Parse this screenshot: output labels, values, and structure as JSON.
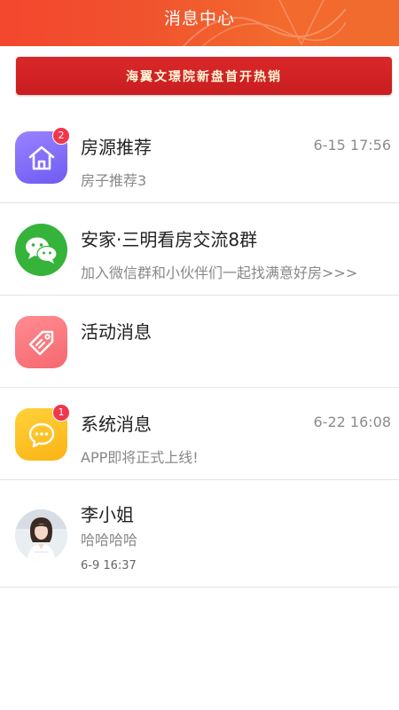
{
  "header": {
    "title": "消息中心"
  },
  "banner": {
    "text": "海翼文璟院新盘首开热销"
  },
  "messages": [
    {
      "title": "房源推荐",
      "subtitle": "房子推荐3",
      "time": "6-15 17:56",
      "badge": "2",
      "icon": "house-icon",
      "color": "#7b68f7"
    },
    {
      "title": "安家·三明看房交流8群",
      "subtitle": "加入微信群和小伙伴们一起找满意好房>>>",
      "icon": "wechat-icon",
      "color": "#35b33a"
    },
    {
      "title": "活动消息",
      "icon": "tag-icon",
      "color": "#f56e76"
    },
    {
      "title": "系统消息",
      "subtitle": "APP即将正式上线!",
      "time": "6-22 16:08",
      "badge": "1",
      "icon": "chat-bubble-icon",
      "color": "#fcbf22"
    },
    {
      "title": "李小姐",
      "subtitle": "哈哈哈哈",
      "time": "6-9 16:37",
      "icon": "avatar"
    }
  ],
  "colors": {
    "header_start": "#f4472e",
    "header_end": "#f06b2e",
    "banner": "#d42326",
    "badge": "#f0374b"
  }
}
